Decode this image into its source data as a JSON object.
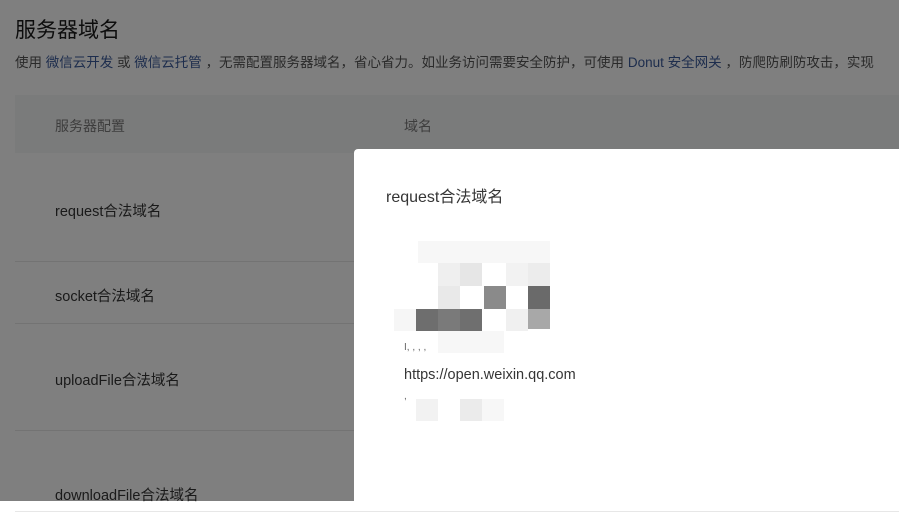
{
  "page": {
    "title": "服务器域名",
    "description": {
      "p1": "使用",
      "link1": "微信云开发",
      "p2": "或",
      "link2": "微信云托管",
      "p3": "，无需配置服务器域名，省心省力。如业务访问需要安全防护，可使用",
      "link3": "Donut 安全网关",
      "p4": "，防爬防刷防攻击，实现"
    }
  },
  "table": {
    "headers": [
      "服务器配置",
      "域名"
    ],
    "rows": [
      {
        "label": "request合法域名"
      },
      {
        "label": "socket合法域名"
      },
      {
        "label": "uploadFile合法域名"
      },
      {
        "label": "downloadFile合法域名"
      }
    ]
  },
  "dialog": {
    "title": "request合法域名",
    "visible_domain": "https://open.weixin.qq.com"
  },
  "colors": {
    "link": "#3b5a9a",
    "mask": "rgba(0,0,0,0.5)"
  }
}
